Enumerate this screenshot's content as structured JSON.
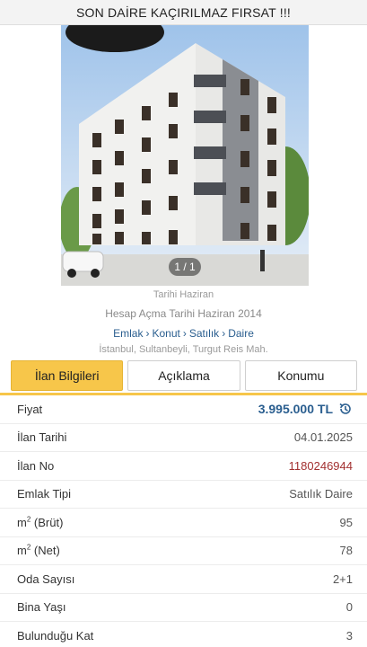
{
  "banner": {
    "title": "SON DAİRE KAÇIRILMAZ FIRSAT !!!"
  },
  "photo": {
    "counter": "1 / 1"
  },
  "meta": {
    "date": "Tarihi Haziran",
    "account": "Hesap Açma Tarihi Haziran 2014",
    "breadcrumb": [
      "Emlak",
      "Konut",
      "Satılık",
      "Daire"
    ],
    "location": "İstanbul, Sultanbeyli, Turgut Reis Mah."
  },
  "tabs": [
    {
      "label": "İlan Bilgileri",
      "active": true
    },
    {
      "label": "Açıklama",
      "active": false
    },
    {
      "label": "Konumu",
      "active": false
    }
  ],
  "details": {
    "price": {
      "label": "Fiyat",
      "value": "3.995.000 TL"
    },
    "listing_date": {
      "label": "İlan Tarihi",
      "value": "04.01.2025"
    },
    "listing_no": {
      "label": "İlan No",
      "value": "1180246944"
    },
    "property_type": {
      "label": "Emlak Tipi",
      "value": "Satılık Daire"
    },
    "gross_area": {
      "label_prefix": "m",
      "label_sup": "2",
      "label_suffix": " (Brüt)",
      "value": "95"
    },
    "net_area": {
      "label_prefix": "m",
      "label_sup": "2",
      "label_suffix": " (Net)",
      "value": "78"
    },
    "rooms": {
      "label": "Oda Sayısı",
      "value": "2+1"
    },
    "building_age": {
      "label": "Bina Yaşı",
      "value": "0"
    },
    "floor": {
      "label": "Bulunduğu Kat",
      "value": "3"
    }
  },
  "colors": {
    "accent": "#f7c64a",
    "link": "#2a5e8f",
    "listing_no": "#a23030"
  },
  "icons": {
    "price_history": "history-icon"
  }
}
